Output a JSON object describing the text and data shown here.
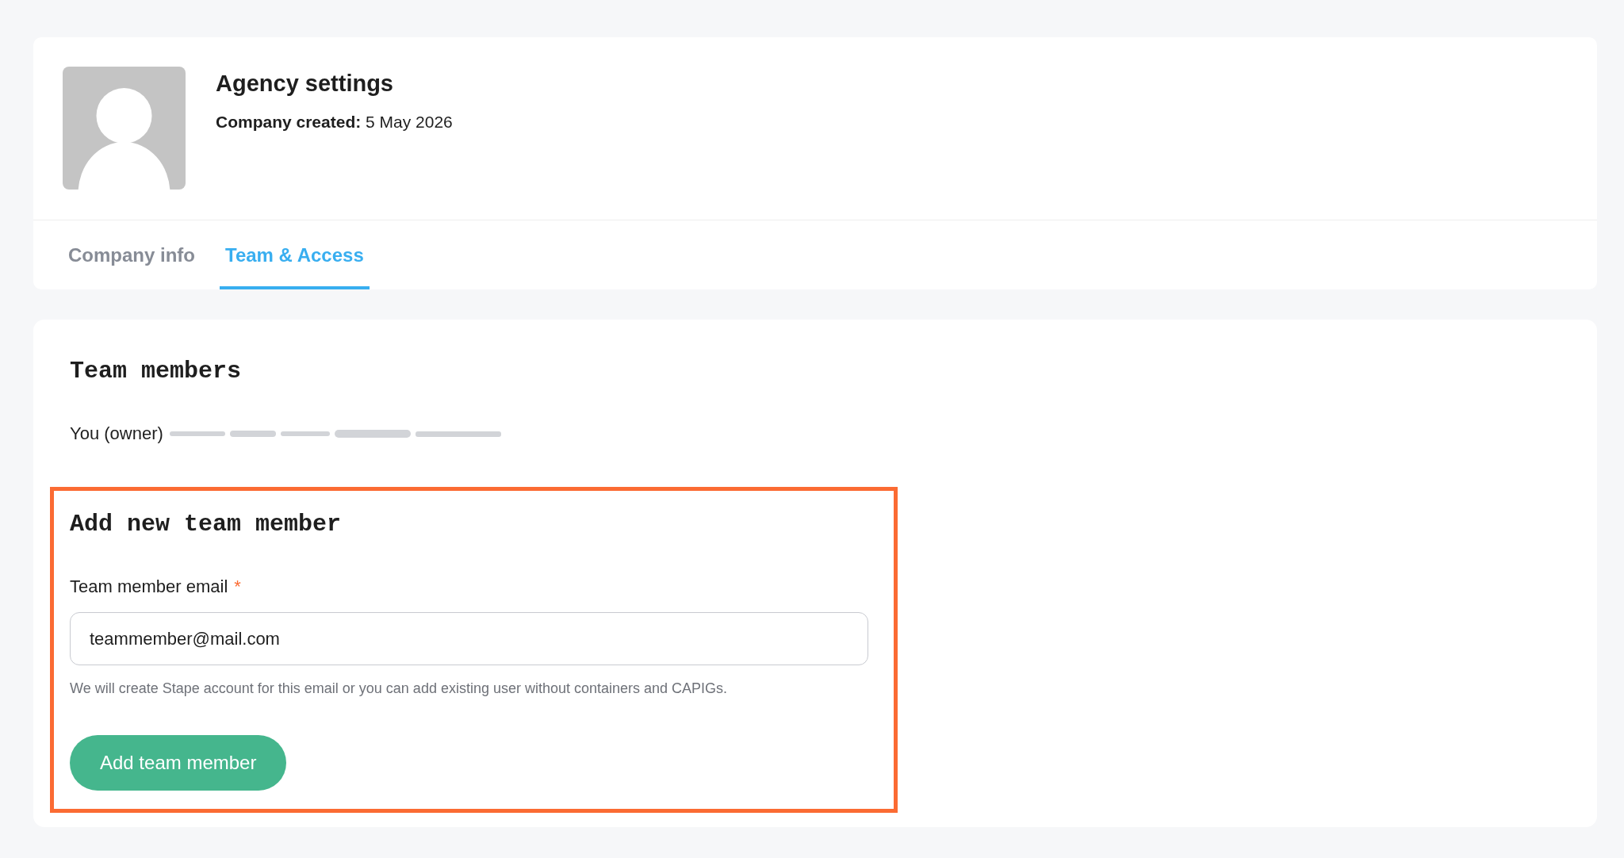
{
  "header": {
    "title": "Agency settings",
    "created": "**Company created:** 5 May 2026"
  },
  "tabs": [
    {
      "label": "Company info",
      "selected": false
    },
    {
      "label": "Team & Access",
      "selected": true
    }
  ],
  "team_members": {
    "title": "Team members",
    "owner_label": "You (owner)"
  },
  "add_member": {
    "title": "Add new team member",
    "email_field": {
      "label": "Team member email",
      "required_mark": "*",
      "value": "teammember@mail.com"
    },
    "hint": "We will create Stape account for this email or you can add existing user without containers and CAPIGs.",
    "button": "Add team member"
  }
}
